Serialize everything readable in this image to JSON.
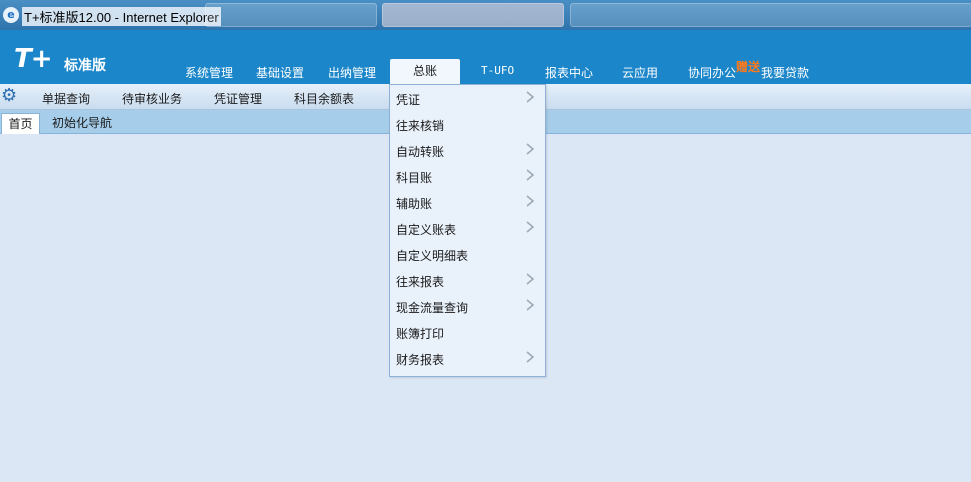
{
  "window": {
    "title": "T+标准版12.00 - Internet Explorer",
    "browser_icon": "ie-icon"
  },
  "logo": {
    "mark": "T+",
    "edition": "标准版"
  },
  "top_nav": [
    {
      "label": "系统管理"
    },
    {
      "label": "基础设置"
    },
    {
      "label": "出纳管理"
    },
    {
      "label": "总账",
      "active": true
    },
    {
      "label": "T-UFO"
    },
    {
      "label": "报表中心"
    },
    {
      "label": "云应用"
    },
    {
      "label": "协同办公"
    },
    {
      "label": "我要贷款"
    }
  ],
  "gift_badge": "赠送",
  "sub_toolbar": {
    "icon": "gear-icon",
    "items": [
      {
        "label": "单据查询"
      },
      {
        "label": "待审核业务"
      },
      {
        "label": "凭证管理"
      },
      {
        "label": "科目余额表"
      }
    ]
  },
  "tabs": [
    {
      "label": "首页",
      "active": true
    },
    {
      "label": "初始化导航"
    }
  ],
  "dropdown": {
    "items": [
      {
        "label": "凭证",
        "has_submenu": true
      },
      {
        "label": "往来核销",
        "has_submenu": false
      },
      {
        "label": "自动转账",
        "has_submenu": true
      },
      {
        "label": "科目账",
        "has_submenu": true
      },
      {
        "label": "辅助账",
        "has_submenu": true
      },
      {
        "label": "自定义账表",
        "has_submenu": true
      },
      {
        "label": "自定义明细表",
        "has_submenu": false
      },
      {
        "label": "往来报表",
        "has_submenu": true
      },
      {
        "label": "现金流量查询",
        "has_submenu": true
      },
      {
        "label": "账簿打印",
        "has_submenu": false
      },
      {
        "label": "财务报表",
        "has_submenu": true
      }
    ]
  },
  "colors": {
    "header": "#1b86c9",
    "tabbar": "#a6cdea",
    "background": "#dce7f6",
    "menu": "#e9f1fb",
    "accent_gift": "#ff7a1a"
  }
}
